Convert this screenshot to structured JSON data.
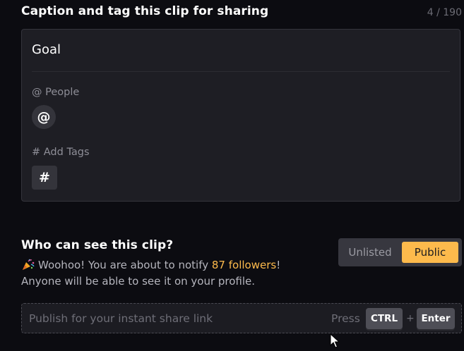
{
  "caption_section": {
    "title": "Caption and tag this clip for sharing",
    "char_count": "4 / 190",
    "caption_value": "Goal",
    "people_label": "@ People",
    "people_button_glyph": "@",
    "tags_label": "# Add Tags",
    "tags_button_glyph": "#"
  },
  "visibility_section": {
    "title": "Who can see this clip?",
    "options": [
      {
        "label": "Unlisted",
        "selected": false
      },
      {
        "label": "Public",
        "selected": true
      }
    ],
    "notify_prefix": "Woohoo! You are about to notify ",
    "followers_text": "87 followers",
    "notify_suffix": "!",
    "profile_note": "Anyone will be able to see it on your profile.",
    "icon": "party-popper-icon"
  },
  "publish": {
    "placeholder": "Publish for your instant share link",
    "press_label": "Press",
    "key1": "CTRL",
    "plus": "+",
    "key2": "Enter"
  },
  "colors": {
    "background": "#0c0c11",
    "card": "#1e1e24",
    "accent": "#fdba4c",
    "muted_text": "#8e8e97"
  }
}
